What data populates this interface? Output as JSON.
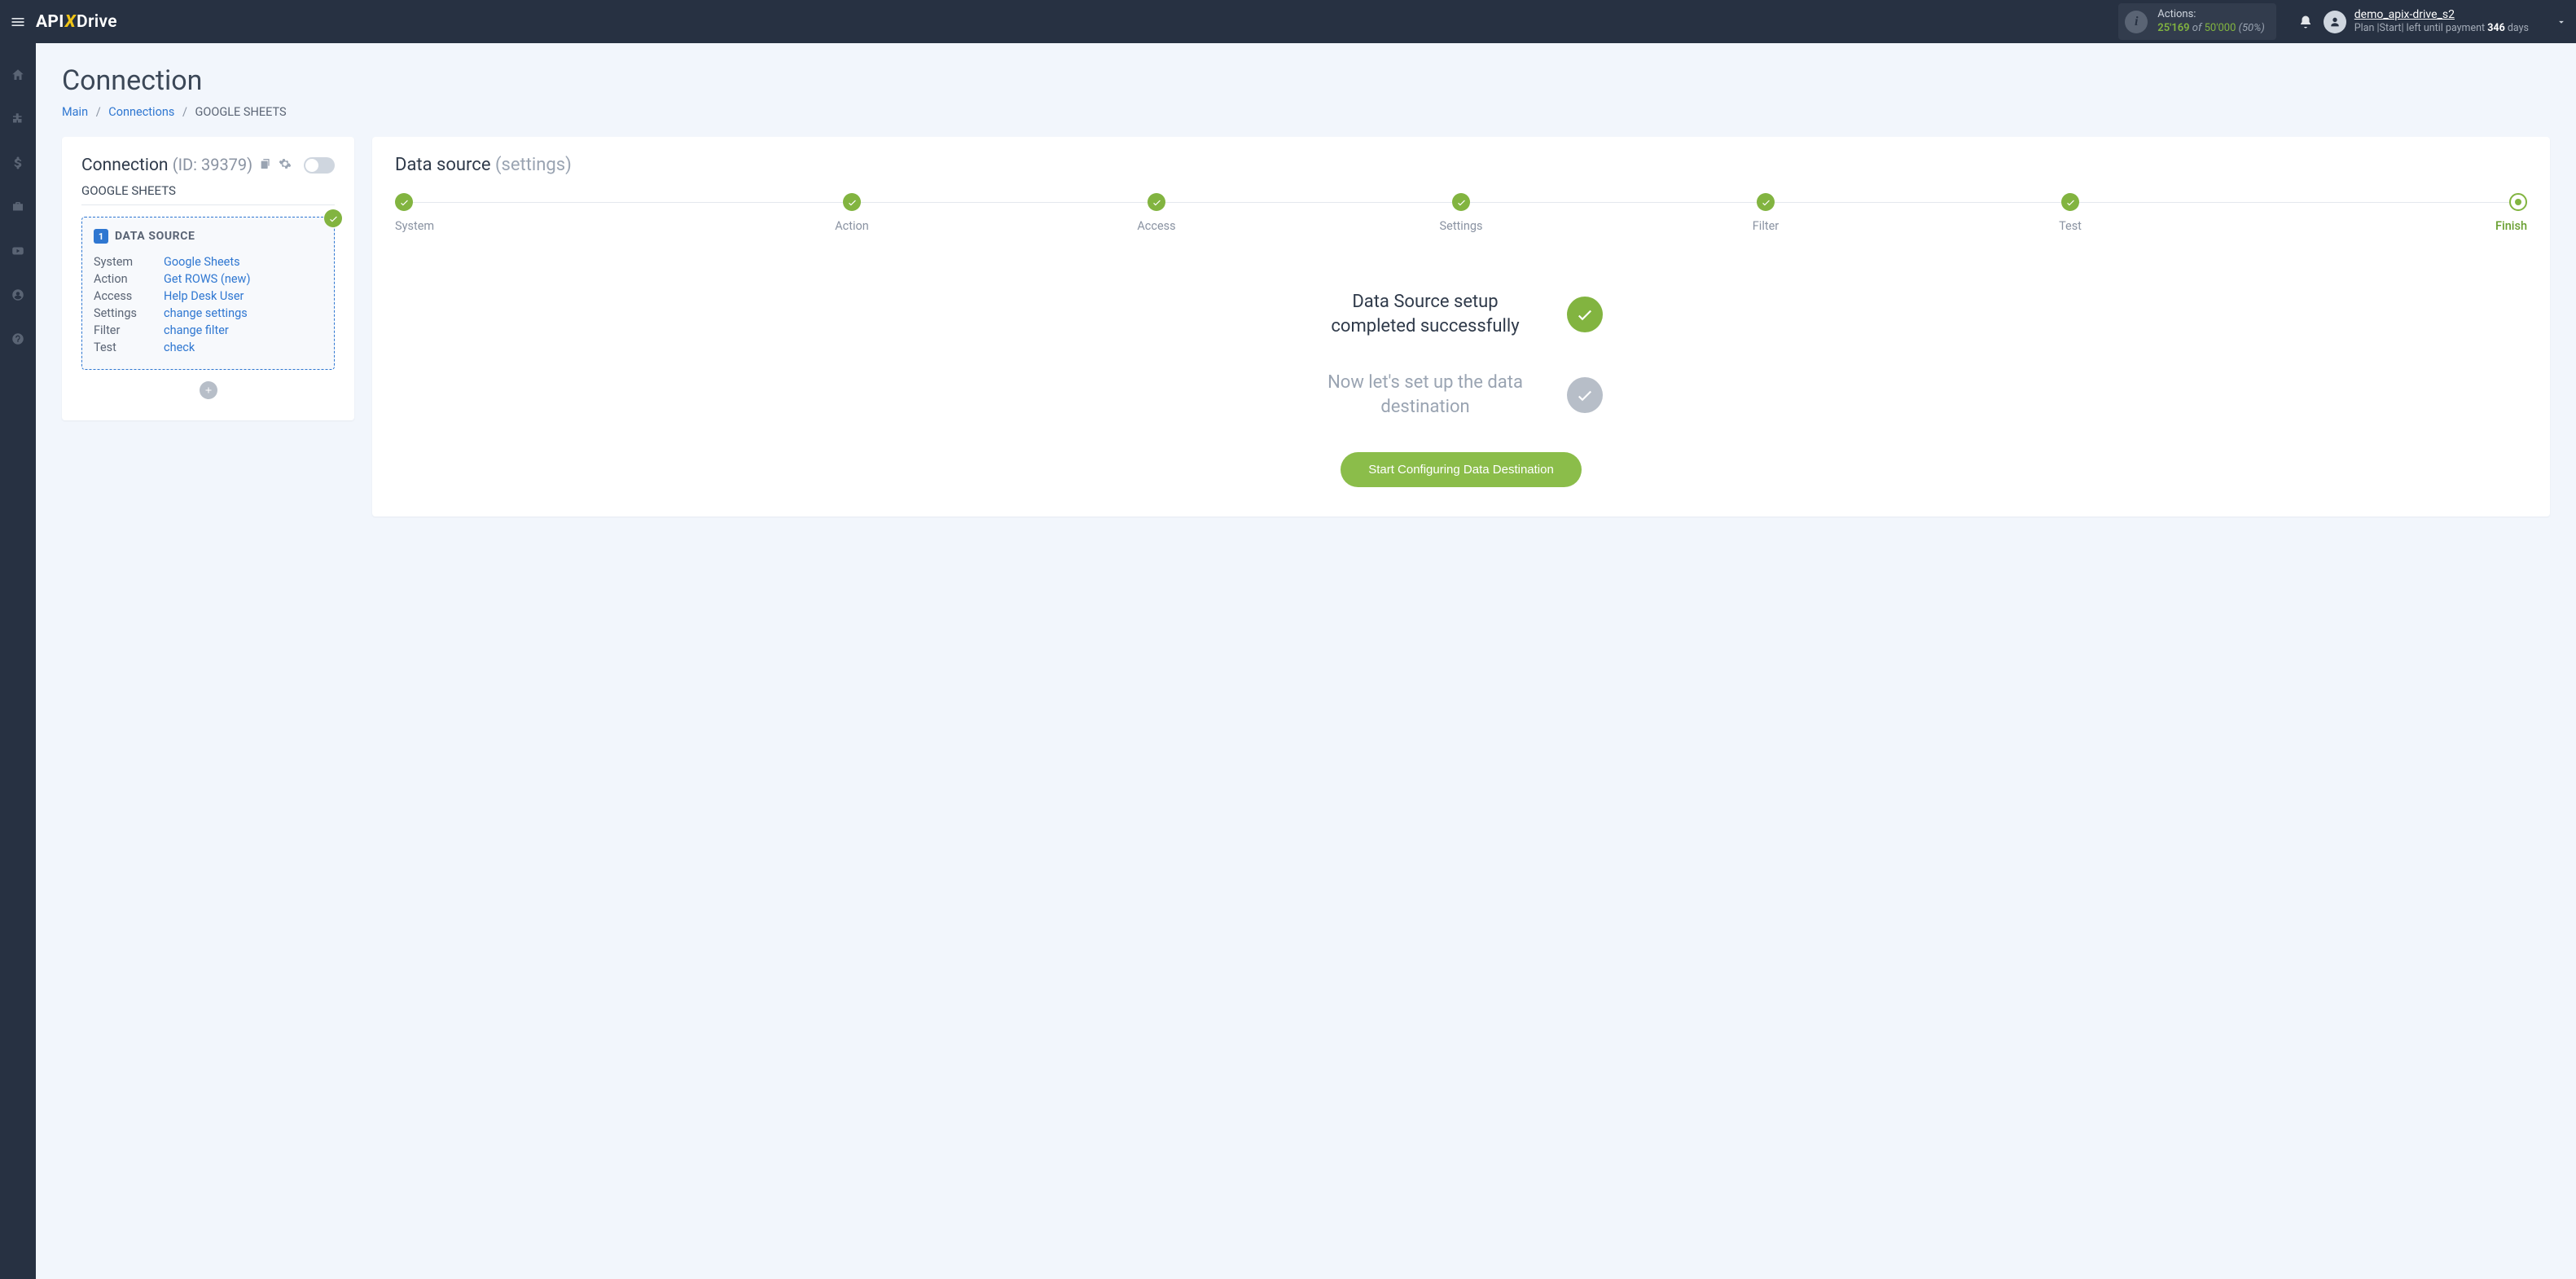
{
  "header": {
    "logo": {
      "api": "API",
      "x": "X",
      "drive": "Drive"
    },
    "actions": {
      "label": "Actions:",
      "count": "25'169",
      "of": "of",
      "max": "50'000",
      "pct": "(50%)"
    },
    "user": {
      "name": "demo_apix-drive_s2",
      "plan_prefix": "Plan |Start| left until payment ",
      "plan_days": "346",
      "plan_suffix": " days"
    }
  },
  "page": {
    "title": "Connection",
    "breadcrumb": {
      "main": "Main",
      "connections": "Connections",
      "current": "GOOGLE SHEETS"
    }
  },
  "left_card": {
    "title": "Connection",
    "id_label": "(ID: 39379)",
    "subtitle": "GOOGLE SHEETS",
    "ds": {
      "num": "1",
      "title": "DATA SOURCE",
      "rows": [
        {
          "k": "System",
          "v": "Google Sheets"
        },
        {
          "k": "Action",
          "v": "Get ROWS (new)"
        },
        {
          "k": "Access",
          "v": "Help Desk User"
        },
        {
          "k": "Settings",
          "v": "change settings"
        },
        {
          "k": "Filter",
          "v": "change filter"
        },
        {
          "k": "Test",
          "v": "check"
        }
      ]
    }
  },
  "right_card": {
    "title": "Data source",
    "title_suffix": "(settings)",
    "steps": [
      "System",
      "Action",
      "Access",
      "Settings",
      "Filter",
      "Test",
      "Finish"
    ],
    "status1": "Data Source setup completed successfully",
    "status2": "Now let's set up the data destination",
    "cta": "Start Configuring Data Destination"
  }
}
